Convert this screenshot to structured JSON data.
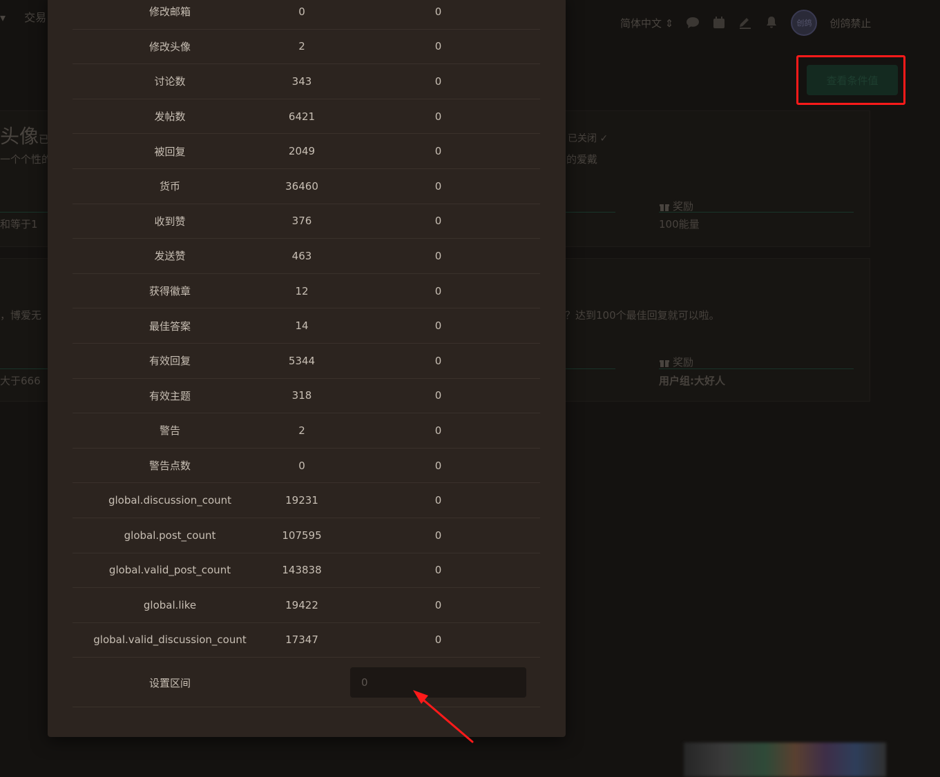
{
  "background": {
    "nav_left_item": "交易",
    "language_select": "简体中文",
    "avatar_text": "创鸽",
    "username": "创鸽禁止",
    "view_button_label": "查看条件值",
    "card1": {
      "title": "头像",
      "title_suffix": "已",
      "description_left": "一个个性的",
      "description_right": "的爱戴",
      "dropdown_text": "已关闭",
      "condition_text": "和等于1",
      "reward_label": "奖励",
      "reward_value": "100能量"
    },
    "card2": {
      "description_left": "，博爱无",
      "description_right": "？达到100个最佳回复就可以啦。",
      "condition_text": "大于666",
      "reward_label": "奖励",
      "reward_value": "用户组:大好人"
    }
  },
  "stats_rows": [
    {
      "name": "修改邮箱",
      "total": "0",
      "value": "0"
    },
    {
      "name": "修改头像",
      "total": "2",
      "value": "0"
    },
    {
      "name": "讨论数",
      "total": "343",
      "value": "0"
    },
    {
      "name": "发帖数",
      "total": "6421",
      "value": "0"
    },
    {
      "name": "被回复",
      "total": "2049",
      "value": "0"
    },
    {
      "name": "货币",
      "total": "36460",
      "value": "0"
    },
    {
      "name": "收到赞",
      "total": "376",
      "value": "0"
    },
    {
      "name": "发送赞",
      "total": "463",
      "value": "0"
    },
    {
      "name": "获得徽章",
      "total": "12",
      "value": "0"
    },
    {
      "name": "最佳答案",
      "total": "14",
      "value": "0"
    },
    {
      "name": "有效回复",
      "total": "5344",
      "value": "0"
    },
    {
      "name": "有效主题",
      "total": "318",
      "value": "0"
    },
    {
      "name": "警告",
      "total": "2",
      "value": "0"
    },
    {
      "name": "警告点数",
      "total": "0",
      "value": "0"
    },
    {
      "name": "global.discussion_count",
      "total": "19231",
      "value": "0"
    },
    {
      "name": "global.post_count",
      "total": "107595",
      "value": "0"
    },
    {
      "name": "global.valid_post_count",
      "total": "143838",
      "value": "0"
    },
    {
      "name": "global.like",
      "total": "19422",
      "value": "0"
    },
    {
      "name": "global.valid_discussion_count",
      "total": "17347",
      "value": "0"
    }
  ],
  "range": {
    "label": "设置区间",
    "value": "0"
  },
  "colors": {
    "annotation": "#ff1a1a",
    "modal_bg": "#2c241f",
    "page_bg": "#141210"
  }
}
